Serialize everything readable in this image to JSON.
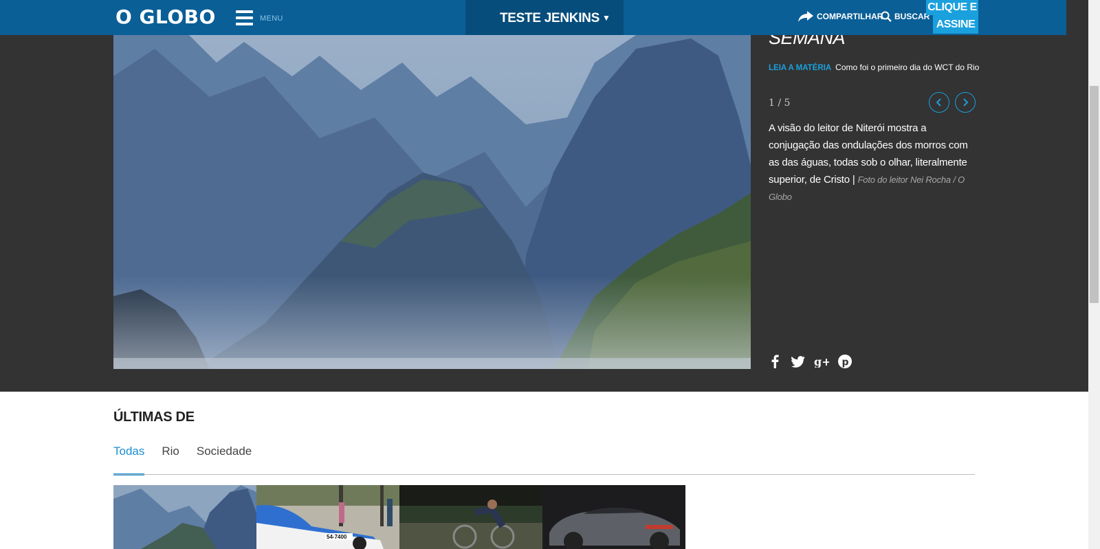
{
  "header": {
    "logo_text": "O GLOBO",
    "menu_label": "MENU",
    "section_label": "TESTE JENKINS",
    "section_caret": "▼",
    "share_label": "COMPARTILHAR",
    "search_label": "BUSCAR",
    "subscribe_line1": "CLIQUE E",
    "subscribe_line2": "ASSINE"
  },
  "gallery": {
    "title_fragment": "SEMANA",
    "read_more_tag": "LEIA A MATÉRIA",
    "read_more_link": "Como foi o primeiro dia do WCT do Rio",
    "counter": "1 / 5",
    "caption_text": "A visão do leitor de Niterói mostra a conjugação das ondulações dos morros com as das águas, todas sob o olhar, literalmente superior, de Cristo |",
    "caption_credit": "Foto do leitor Nei Rocha / O Globo",
    "social_icons": [
      "facebook-icon",
      "twitter-icon",
      "google-plus-icon",
      "pinterest-icon"
    ]
  },
  "latest": {
    "title": "ÚLTIMAS DE",
    "tabs": [
      {
        "label": "Todas",
        "active": true
      },
      {
        "label": "Rio",
        "active": false
      },
      {
        "label": "Sociedade",
        "active": false
      }
    ]
  },
  "colors": {
    "header_bg": "#0a5f97",
    "accent": "#1aa0dd",
    "gallery_bg": "#333333"
  }
}
